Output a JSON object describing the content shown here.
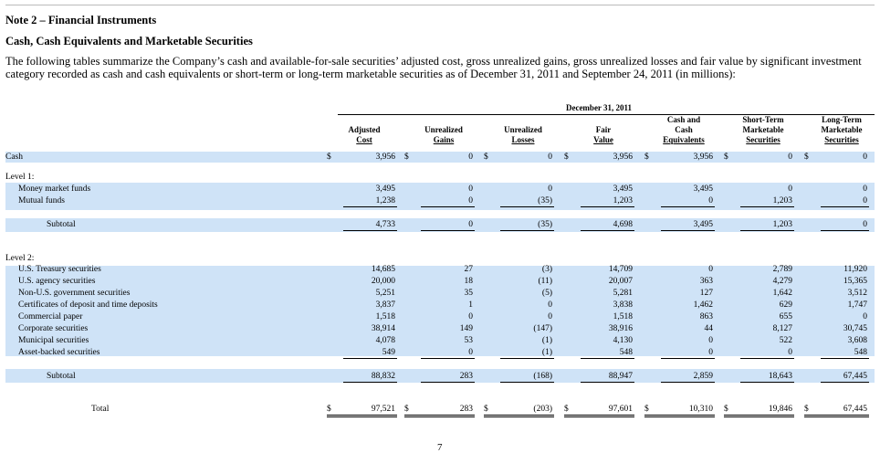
{
  "note_title": "Note 2 – Financial Instruments",
  "section_title": "Cash, Cash Equivalents and Marketable Securities",
  "intro": "The following tables summarize the Company’s cash and available-for-sale securities’ adjusted cost, gross unrealized gains, gross unrealized losses and fair value by significant investment category recorded as cash and cash equivalents or short-term or long-term marketable securities as of December 31, 2011 and September 24, 2011 (in millions):",
  "period": "December 31, 2011",
  "currency": "$",
  "columns": [
    {
      "l1": "",
      "l2": "Adjusted",
      "l3": "Cost"
    },
    {
      "l1": "",
      "l2": "Unrealized",
      "l3": "Gains"
    },
    {
      "l1": "",
      "l2": "Unrealized",
      "l3": "Losses"
    },
    {
      "l1": "",
      "l2": "Fair",
      "l3": "Value"
    },
    {
      "l1": "Cash and",
      "l2": "Cash",
      "l3": "Equivalents"
    },
    {
      "l1": "Short-Term",
      "l2": "Marketable",
      "l3": "Securities"
    },
    {
      "l1": "Long-Term",
      "l2": "Marketable",
      "l3": "Securities"
    }
  ],
  "cash_row": {
    "label": "Cash",
    "values": [
      "3,956",
      "0",
      "0",
      "3,956",
      "3,956",
      "0",
      "0"
    ]
  },
  "level1": {
    "title": "Level 1:",
    "rows": [
      {
        "label": "Money market funds",
        "values": [
          "3,495",
          "0",
          "0",
          "3,495",
          "3,495",
          "0",
          "0"
        ]
      },
      {
        "label": "Mutual funds",
        "values": [
          "1,238",
          "0",
          "(35)",
          "1,203",
          "0",
          "1,203",
          "0"
        ]
      }
    ],
    "subtotal": {
      "label": "Subtotal",
      "values": [
        "4,733",
        "0",
        "(35)",
        "4,698",
        "3,495",
        "1,203",
        "0"
      ]
    }
  },
  "level2": {
    "title": "Level 2:",
    "rows": [
      {
        "label": "U.S. Treasury securities",
        "values": [
          "14,685",
          "27",
          "(3)",
          "14,709",
          "0",
          "2,789",
          "11,920"
        ]
      },
      {
        "label": "U.S. agency securities",
        "values": [
          "20,000",
          "18",
          "(11)",
          "20,007",
          "363",
          "4,279",
          "15,365"
        ]
      },
      {
        "label": "Non-U.S. government securities",
        "values": [
          "5,251",
          "35",
          "(5)",
          "5,281",
          "127",
          "1,642",
          "3,512"
        ]
      },
      {
        "label": "Certificates of deposit and time deposits",
        "values": [
          "3,837",
          "1",
          "0",
          "3,838",
          "1,462",
          "629",
          "1,747"
        ]
      },
      {
        "label": "Commercial paper",
        "values": [
          "1,518",
          "0",
          "0",
          "1,518",
          "863",
          "655",
          "0"
        ]
      },
      {
        "label": "Corporate securities",
        "values": [
          "38,914",
          "149",
          "(147)",
          "38,916",
          "44",
          "8,127",
          "30,745"
        ]
      },
      {
        "label": "Municipal securities",
        "values": [
          "4,078",
          "53",
          "(1)",
          "4,130",
          "0",
          "522",
          "3,608"
        ]
      },
      {
        "label": "Asset-backed securities",
        "values": [
          "549",
          "0",
          "(1)",
          "548",
          "0",
          "0",
          "548"
        ]
      }
    ],
    "subtotal": {
      "label": "Subtotal",
      "values": [
        "88,832",
        "283",
        "(168)",
        "88,947",
        "2,859",
        "18,643",
        "67,445"
      ]
    }
  },
  "total": {
    "label": "Total",
    "values": [
      "97,521",
      "283",
      "(203)",
      "97,601",
      "10,310",
      "19,846",
      "67,445"
    ]
  },
  "page_number": "7"
}
